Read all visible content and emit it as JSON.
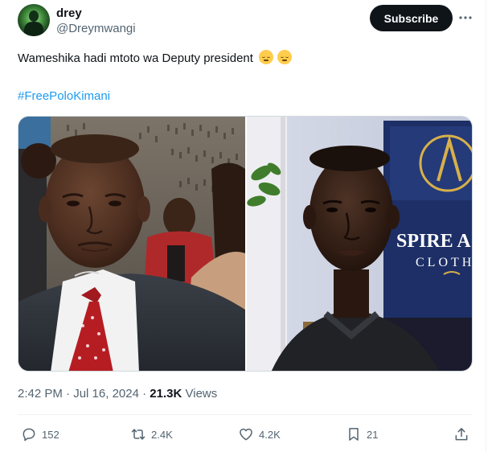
{
  "author": {
    "display_name": "drey",
    "handle": "@Dreymwangi"
  },
  "header": {
    "subscribe_label": "Subscribe",
    "more_icon": "more-horizontal-icon"
  },
  "tweet": {
    "text": "Wameshika hadi mtoto wa Deputy president",
    "emojis": [
      "relieved-face-emoji",
      "relieved-face-emoji"
    ],
    "hashtag": "#FreePoloKimani",
    "media": {
      "photo_count": 2,
      "right_photo_sign_top": "SPIRE A",
      "right_photo_sign_bottom": "CLOTH"
    }
  },
  "meta": {
    "time": "2:42 PM",
    "separator": "·",
    "date": "Jul 16, 2024",
    "views_count": "21.3K",
    "views_label": "Views"
  },
  "actions": {
    "replies": "152",
    "reposts": "2.4K",
    "likes": "4.2K",
    "bookmarks": "21",
    "icons": [
      "reply-icon",
      "repost-icon",
      "like-icon",
      "bookmark-icon",
      "share-icon"
    ]
  },
  "colors": {
    "accent": "#1d9bf0",
    "text": "#0f1419",
    "secondary": "#536471",
    "button": "#0f1419"
  }
}
